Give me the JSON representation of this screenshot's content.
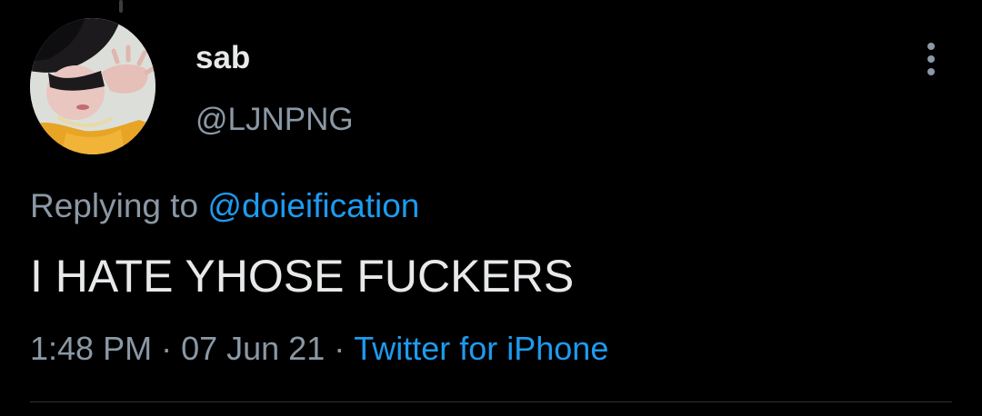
{
  "tweet": {
    "display_name": "sab",
    "handle": "@LJNPNG",
    "replying_prefix": "Replying to",
    "replying_to": "@doieification",
    "text": "I HATE YHOSE FUCKERS",
    "time": "1:48 PM",
    "separator": "·",
    "date": "07 Jun 21",
    "source": "Twitter for iPhone"
  },
  "icons": {
    "more": "more-vertical-icon",
    "avatar": "profile-photo"
  },
  "colors": {
    "background": "#000000",
    "primary_text": "#e7e9ea",
    "secondary_text": "#8b98a5",
    "link": "#1d9bf0",
    "divider": "#2f3336"
  }
}
